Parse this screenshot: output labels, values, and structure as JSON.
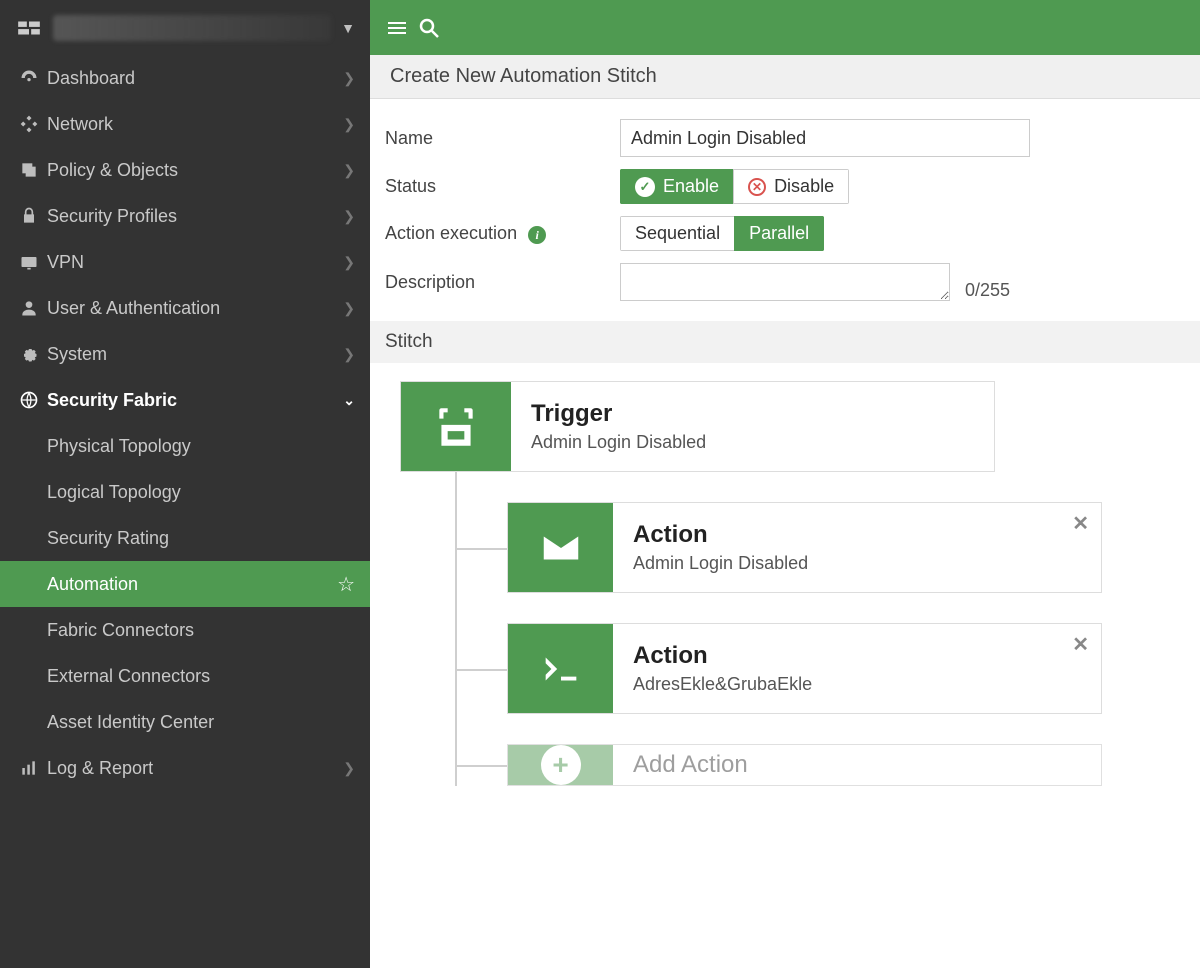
{
  "sidebar": {
    "items": [
      {
        "label": "Dashboard"
      },
      {
        "label": "Network"
      },
      {
        "label": "Policy & Objects"
      },
      {
        "label": "Security Profiles"
      },
      {
        "label": "VPN"
      },
      {
        "label": "User & Authentication"
      },
      {
        "label": "System"
      },
      {
        "label": "Security Fabric"
      },
      {
        "label": "Log & Report"
      }
    ],
    "sub_items": [
      {
        "label": "Physical Topology"
      },
      {
        "label": "Logical Topology"
      },
      {
        "label": "Security Rating"
      },
      {
        "label": "Automation"
      },
      {
        "label": "Fabric Connectors"
      },
      {
        "label": "External Connectors"
      },
      {
        "label": "Asset Identity Center"
      }
    ]
  },
  "page_title": "Create New Automation Stitch",
  "form": {
    "name_label": "Name",
    "name_value": "Admin Login Disabled",
    "status_label": "Status",
    "status_enable": "Enable",
    "status_disable": "Disable",
    "exec_label": "Action execution",
    "exec_sequential": "Sequential",
    "exec_parallel": "Parallel",
    "desc_label": "Description",
    "desc_value": "",
    "desc_count": "0/255"
  },
  "stitch": {
    "section_title": "Stitch",
    "trigger": {
      "title": "Trigger",
      "sub": "Admin Login Disabled"
    },
    "actions": [
      {
        "title": "Action",
        "sub": "Admin Login Disabled",
        "icon": "mail"
      },
      {
        "title": "Action",
        "sub": "AdresEkle&GrubaEkle",
        "icon": "cli"
      }
    ],
    "add_label": "Add Action"
  }
}
